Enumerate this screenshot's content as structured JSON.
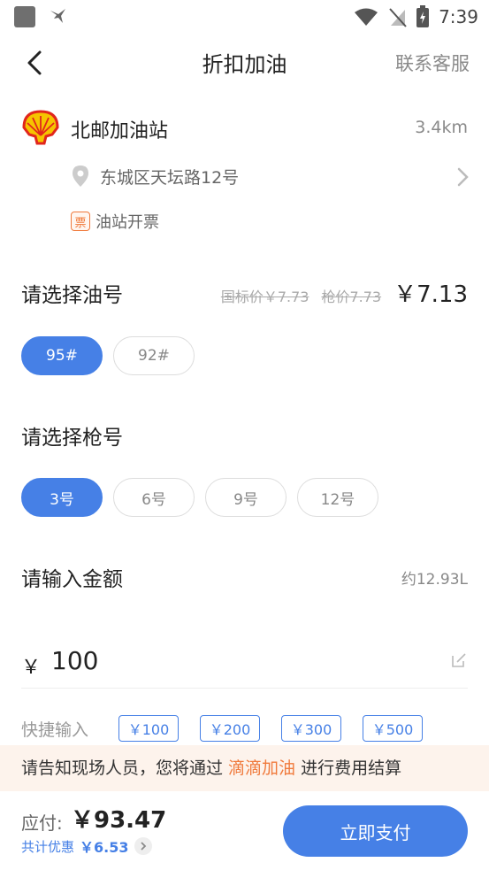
{
  "status_bar": {
    "time": "7:39"
  },
  "nav": {
    "title": "折扣加油",
    "customer_service": "联系客服"
  },
  "station": {
    "name": "北邮加油站",
    "distance": "3.4km",
    "address": "东城区天坛路12号",
    "invoice_badge": "票",
    "invoice_text": "油站开票"
  },
  "fuel": {
    "label": "请选择油号",
    "national_price": "国标价￥7.73",
    "pump_price": "枪价7.73",
    "price": "￥7.13",
    "options": [
      "95#",
      "92#"
    ],
    "selected": "95#"
  },
  "gun": {
    "label": "请选择枪号",
    "options": [
      "3号",
      "6号",
      "9号",
      "12号"
    ],
    "selected": "3号"
  },
  "amount": {
    "label": "请输入金额",
    "liters": "约12.93L",
    "currency": "￥",
    "value": "100"
  },
  "quick": {
    "label": "快捷输入",
    "options": [
      "￥100",
      "￥200",
      "￥300",
      "￥500"
    ]
  },
  "notice": {
    "prefix": "请告知现场人员，您将通过 ",
    "highlight": "滴滴加油",
    "suffix": " 进行费用结算"
  },
  "footer": {
    "pay_label": "应付:",
    "pay_amount": "￥93.47",
    "discount_label": "共计优惠",
    "discount_amount": "￥6.53",
    "pay_button": "立即支付"
  },
  "colors": {
    "primary": "#4680e6",
    "accent": "#f07a3c",
    "notice_bg": "#fdf3ec"
  }
}
